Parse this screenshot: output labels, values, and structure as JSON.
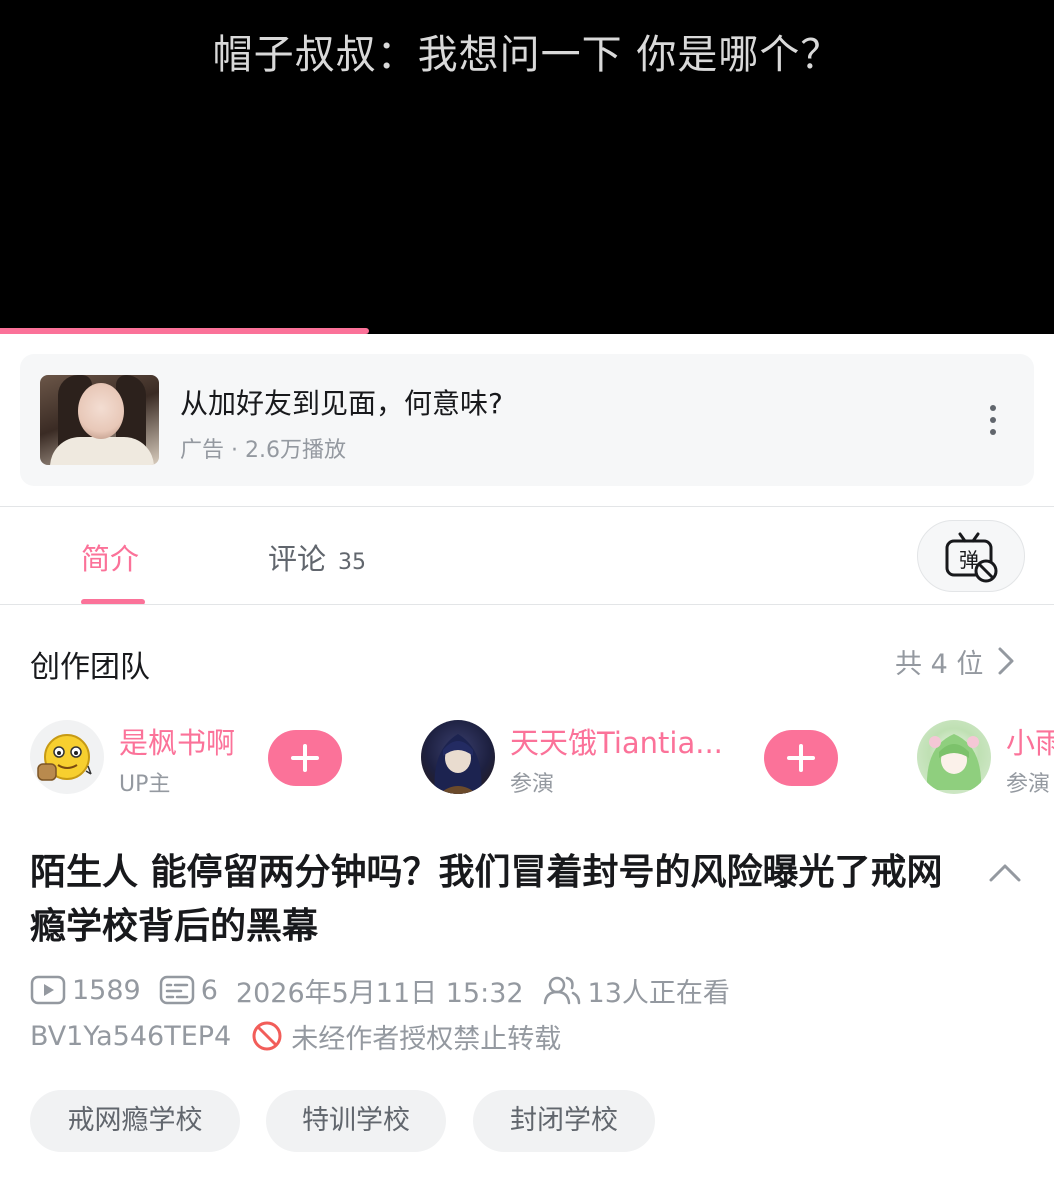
{
  "player": {
    "subtitle": "帽子叔叔：我想问一下  你是哪个？",
    "progress_fraction": 0.35,
    "progress_color": "#fb7299"
  },
  "ad": {
    "title": "从加好友到见面，何意味?",
    "meta": "广告 · 2.6万播放",
    "more_icon": "more-vertical-icon"
  },
  "tabs": [
    {
      "label": "简介",
      "active": true
    },
    {
      "label": "评论",
      "count": "35",
      "active": false
    }
  ],
  "danmaku": {
    "icon": "danmaku-off-icon",
    "glyph": "弹"
  },
  "team": {
    "title": "创作团队",
    "count_label": "共 4 位",
    "members": [
      {
        "name": "是枫书啊",
        "role": "UP主"
      },
      {
        "name": "天天饿Tiantia...",
        "role": "参演"
      },
      {
        "name": "小雨",
        "role": "参演"
      }
    ]
  },
  "video": {
    "title": "陌生人 能停留两分钟吗？我们冒着封号的风险曝光了戒网瘾学校背后的黑幕",
    "plays": "1589",
    "danmaku_count": "6",
    "date": "2026年5月11日 15:32",
    "watching": "13人正在看",
    "bvid": "BV1Ya546TEP4",
    "copyright": "未经作者授权禁止转载"
  },
  "tags": [
    "戒网瘾学校",
    "特训学校",
    "封闭学校"
  ],
  "colors": {
    "accent": "#fb7299",
    "text_secondary": "#9499a0",
    "card_bg": "#f6f7f8"
  }
}
